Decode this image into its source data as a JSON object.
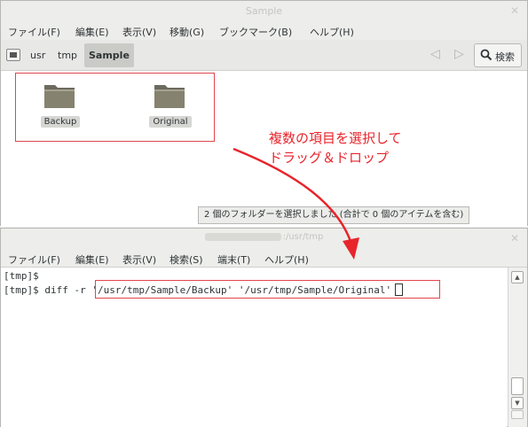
{
  "file_manager": {
    "title": "Sample",
    "menu": [
      "ファイル(F)",
      "編集(E)",
      "表示(V)",
      "移動(G)",
      "ブックマーク(B)",
      "ヘルプ(H)"
    ],
    "breadcrumbs": [
      "usr",
      "tmp",
      "Sample"
    ],
    "search_label": "検索",
    "folders": [
      {
        "label": "Backup",
        "selected": true
      },
      {
        "label": "Original",
        "selected": true
      }
    ],
    "status": "2 個のフォルダーを選択しました (合計で 0 個のアイテムを含む)"
  },
  "annotation": {
    "line1": "複数の項目を選択して",
    "line2": "ドラッグ＆ドロップ",
    "color": "#e8242b"
  },
  "terminal": {
    "title": ":/usr/tmp",
    "menu": [
      "ファイル(F)",
      "編集(E)",
      "表示(V)",
      "検索(S)",
      "端末(T)",
      "ヘルプ(H)"
    ],
    "lines": [
      "[tmp]$",
      "[tmp]$ diff -r "
    ],
    "command_paths": "'/usr/tmp/Sample/Backup' '/usr/tmp/Sample/Original'"
  },
  "colors": {
    "highlight_red": "#e0464d",
    "folder_body": "#7d7a6e"
  }
}
